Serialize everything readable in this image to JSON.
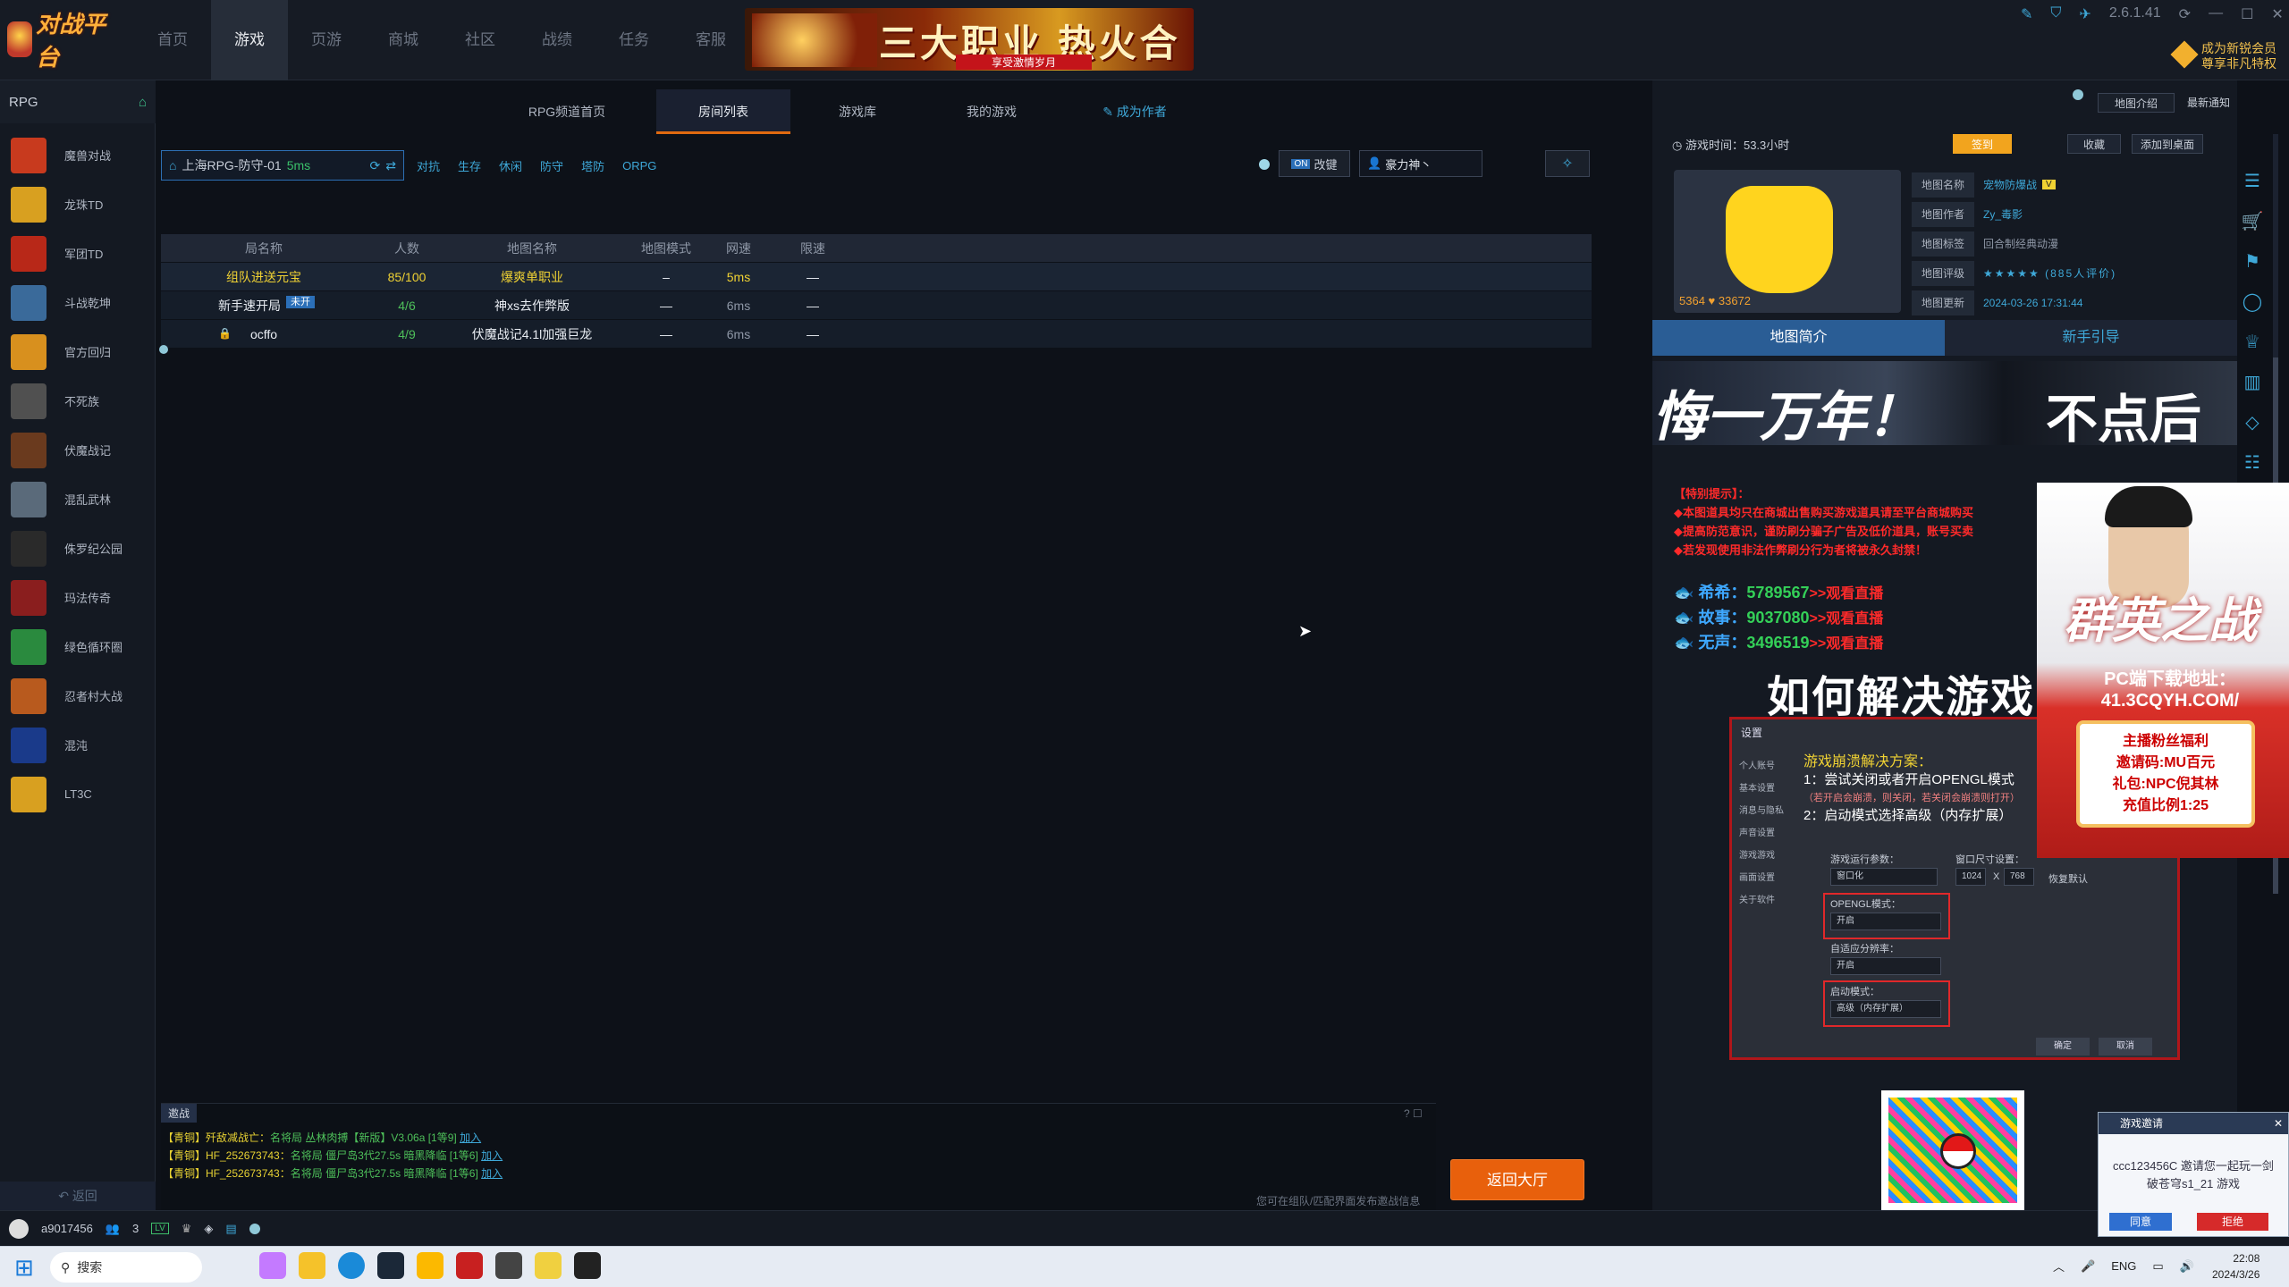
{
  "app": {
    "logo": "对战平台",
    "version": "2.6.1.41",
    "vip_text": "成为新锐会员 尊享非凡特权"
  },
  "nav": [
    "首页",
    "游戏",
    "页游",
    "商城",
    "社区",
    "战绩",
    "任务",
    "客服"
  ],
  "nav_active": 1,
  "banner": {
    "title": "三大职业 热火合击",
    "subtitle": "享受激情岁月"
  },
  "sidebar": {
    "header": "RPG",
    "games": [
      "魔兽对战",
      "龙珠TD",
      "军团TD",
      "斗战乾坤",
      "官方回归",
      "不死族",
      "伏魔战记",
      "混乱武林",
      "侏罗纪公园",
      "玛法传奇",
      "绿色循环圈",
      "忍者村大战",
      "混沌",
      "LT3C"
    ],
    "back": "返回"
  },
  "subtabs": [
    "RPG频道首页",
    "房间列表",
    "游戏库",
    "我的游戏",
    "成为作者"
  ],
  "subtab_active": 1,
  "toolbar": {
    "server": "上海RPG-防守-01",
    "ping": "5ms",
    "filters": [
      "对抗",
      "生存",
      "休闲",
      "防守",
      "塔防",
      "ORPG"
    ],
    "changekey": "改键",
    "hero": "豪力神丶"
  },
  "table": {
    "headers": [
      "局名称",
      "人数",
      "地图名称",
      "地图模式",
      "网速",
      "限速"
    ],
    "rows": [
      {
        "name": "组队进送元宝",
        "count": "85/100",
        "map": "爆爽单职业",
        "mode": "–",
        "speed": "5ms",
        "limit": "—",
        "style": "yel",
        "badge": ""
      },
      {
        "name": "新手速开局",
        "count": "4/6",
        "map": "神xs去作弊版",
        "mode": "—",
        "speed": "6ms",
        "limit": "—",
        "style": "",
        "badge": "未开"
      },
      {
        "name": "ocffo",
        "count": "4/9",
        "map": "伏魔战记4.1l加强巨龙",
        "mode": "—",
        "speed": "6ms",
        "limit": "—",
        "style": "",
        "badge": ""
      }
    ]
  },
  "chat": {
    "tab": "邀战",
    "lines": [
      {
        "user": "【青铜】歼敌减战亡：",
        "text": "名将局 丛林肉搏【新版】V3.06a [1等9]",
        "link": "加入"
      },
      {
        "user": "【青铜】HF_252673743：",
        "text": "名将局 僵尸岛3代27.5s 暗黑降临 [1等6]",
        "link": "加入"
      },
      {
        "user": "【青铜】HF_252673743：",
        "text": "名将局 僵尸岛3代27.5s 暗黑降临 [1等6]",
        "link": "加入"
      }
    ],
    "hint": "您可在组队/匹配界面发布邀战信息"
  },
  "return_btn": "返回大厅",
  "status": {
    "user": "a9017456",
    "friends": "3"
  },
  "right": {
    "intro_btn": "地图介绍",
    "notice_btn": "最新通知",
    "playtime": "游戏时间：53.3小时",
    "sign": "签到",
    "fav": "收藏",
    "desk": "添加到桌面",
    "map_stats": "5364 ♥ 33672",
    "info": [
      {
        "k": "地图名称",
        "v": "宠物防爆战",
        "tag": "V"
      },
      {
        "k": "地图作者",
        "v": "Zy_毒影"
      },
      {
        "k": "地图标签",
        "v": "回合制经典动漫"
      },
      {
        "k": "地图评级",
        "v": "★★★★★ (885人评价)"
      },
      {
        "k": "地图更新",
        "v": "2024-03-26 17:31:44"
      }
    ],
    "tabs": [
      "地图简介",
      "新手引导"
    ],
    "promo": [
      "悔一万年！",
      "不点后"
    ],
    "notice": [
      "【特别提示】：",
      "◆本图道具均只在商城出售购买游戏道具请至平台商城购买",
      "◆提高防范意识，谨防刷分骗子广告及低价道具，账号买卖",
      "◆若发现使用非法作弊刷分行为者将被永久封禁！"
    ],
    "streams": [
      {
        "name": "希希：",
        "num": "5789567",
        "link": ">>观看直播"
      },
      {
        "name": "故事：",
        "num": "9037080",
        "link": ">>观看直播"
      },
      {
        "name": "无声：",
        "num": "3496519",
        "link": ">>观看直播"
      }
    ],
    "howto": "如何解决游戏",
    "dialog": {
      "title": "设置",
      "menu": [
        "个人账号",
        "基本设置",
        "消息与隐私",
        "声音设置",
        "游戏游戏",
        "画面设置",
        "关于软件"
      ],
      "sol_title": "游戏崩溃解决方案：",
      "sol1": "1：尝试关闭或者开启OPENGL模式",
      "sol1b": "（若开启会崩溃，则关闭，若关闭会崩溃则打开）",
      "sol2": "2：启动模式选择高级（内存扩展）",
      "param": "游戏运行参数：",
      "winsize": "窗口尺寸设置：",
      "mode": "窗口化",
      "w": "1024",
      "h": "768",
      "restore": "恢复默认",
      "opengl": "OPENGL模式：",
      "on": "开启",
      "adapt": "自适应分辨率：",
      "launch": "启动模式：",
      "adv": "高级（内存扩展）",
      "ok": "确定",
      "cancel": "取消"
    }
  },
  "ad": {
    "title": "群英之战",
    "url": "PC端下载地址：41.3CQYH.COM/",
    "l1": "主播粉丝福利",
    "l2": "邀请码:MU百元",
    "l3": "礼包:NPC倪其林",
    "l4": "充值比例1:25"
  },
  "invite": {
    "title": "游戏邀请",
    "msg": "ccc123456C 邀请您一起玩一剑破苍穹s1_21 游戏",
    "accept": "同意",
    "reject": "拒绝"
  },
  "taskbar": {
    "search": "搜索",
    "lang": "ENG",
    "time": "22:08",
    "date": "2024/3/26"
  }
}
